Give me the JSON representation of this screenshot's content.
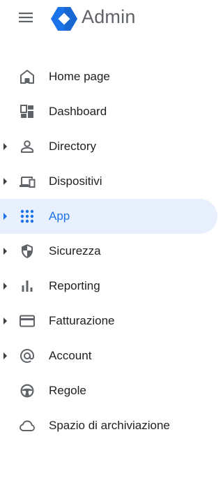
{
  "app": {
    "title": "Admin",
    "menu_icon": "hamburger-menu-icon",
    "logo_icon": "admin-hexagon-logo",
    "brand_color": "#1a73e8"
  },
  "sidebar": {
    "active_color": "#1a73e8",
    "active_background": "#e8f0fe",
    "items": [
      {
        "label": "Home page",
        "icon": "home-icon",
        "expandable": false,
        "active": false
      },
      {
        "label": "Dashboard",
        "icon": "dashboard-icon",
        "expandable": false,
        "active": false
      },
      {
        "label": "Directory",
        "icon": "person-icon",
        "expandable": true,
        "active": false
      },
      {
        "label": "Dispositivi",
        "icon": "devices-icon",
        "expandable": true,
        "active": false
      },
      {
        "label": "App",
        "icon": "apps-grid-icon",
        "expandable": true,
        "active": true
      },
      {
        "label": "Sicurezza",
        "icon": "shield-icon",
        "expandable": true,
        "active": false
      },
      {
        "label": "Reporting",
        "icon": "bar-chart-icon",
        "expandable": true,
        "active": false
      },
      {
        "label": "Fatturazione",
        "icon": "credit-card-icon",
        "expandable": true,
        "active": false
      },
      {
        "label": "Account",
        "icon": "at-sign-icon",
        "expandable": true,
        "active": false
      },
      {
        "label": "Regole",
        "icon": "steering-wheel-icon",
        "expandable": false,
        "active": false
      },
      {
        "label": "Spazio di archiviazione",
        "icon": "cloud-icon",
        "expandable": false,
        "active": false
      }
    ]
  }
}
